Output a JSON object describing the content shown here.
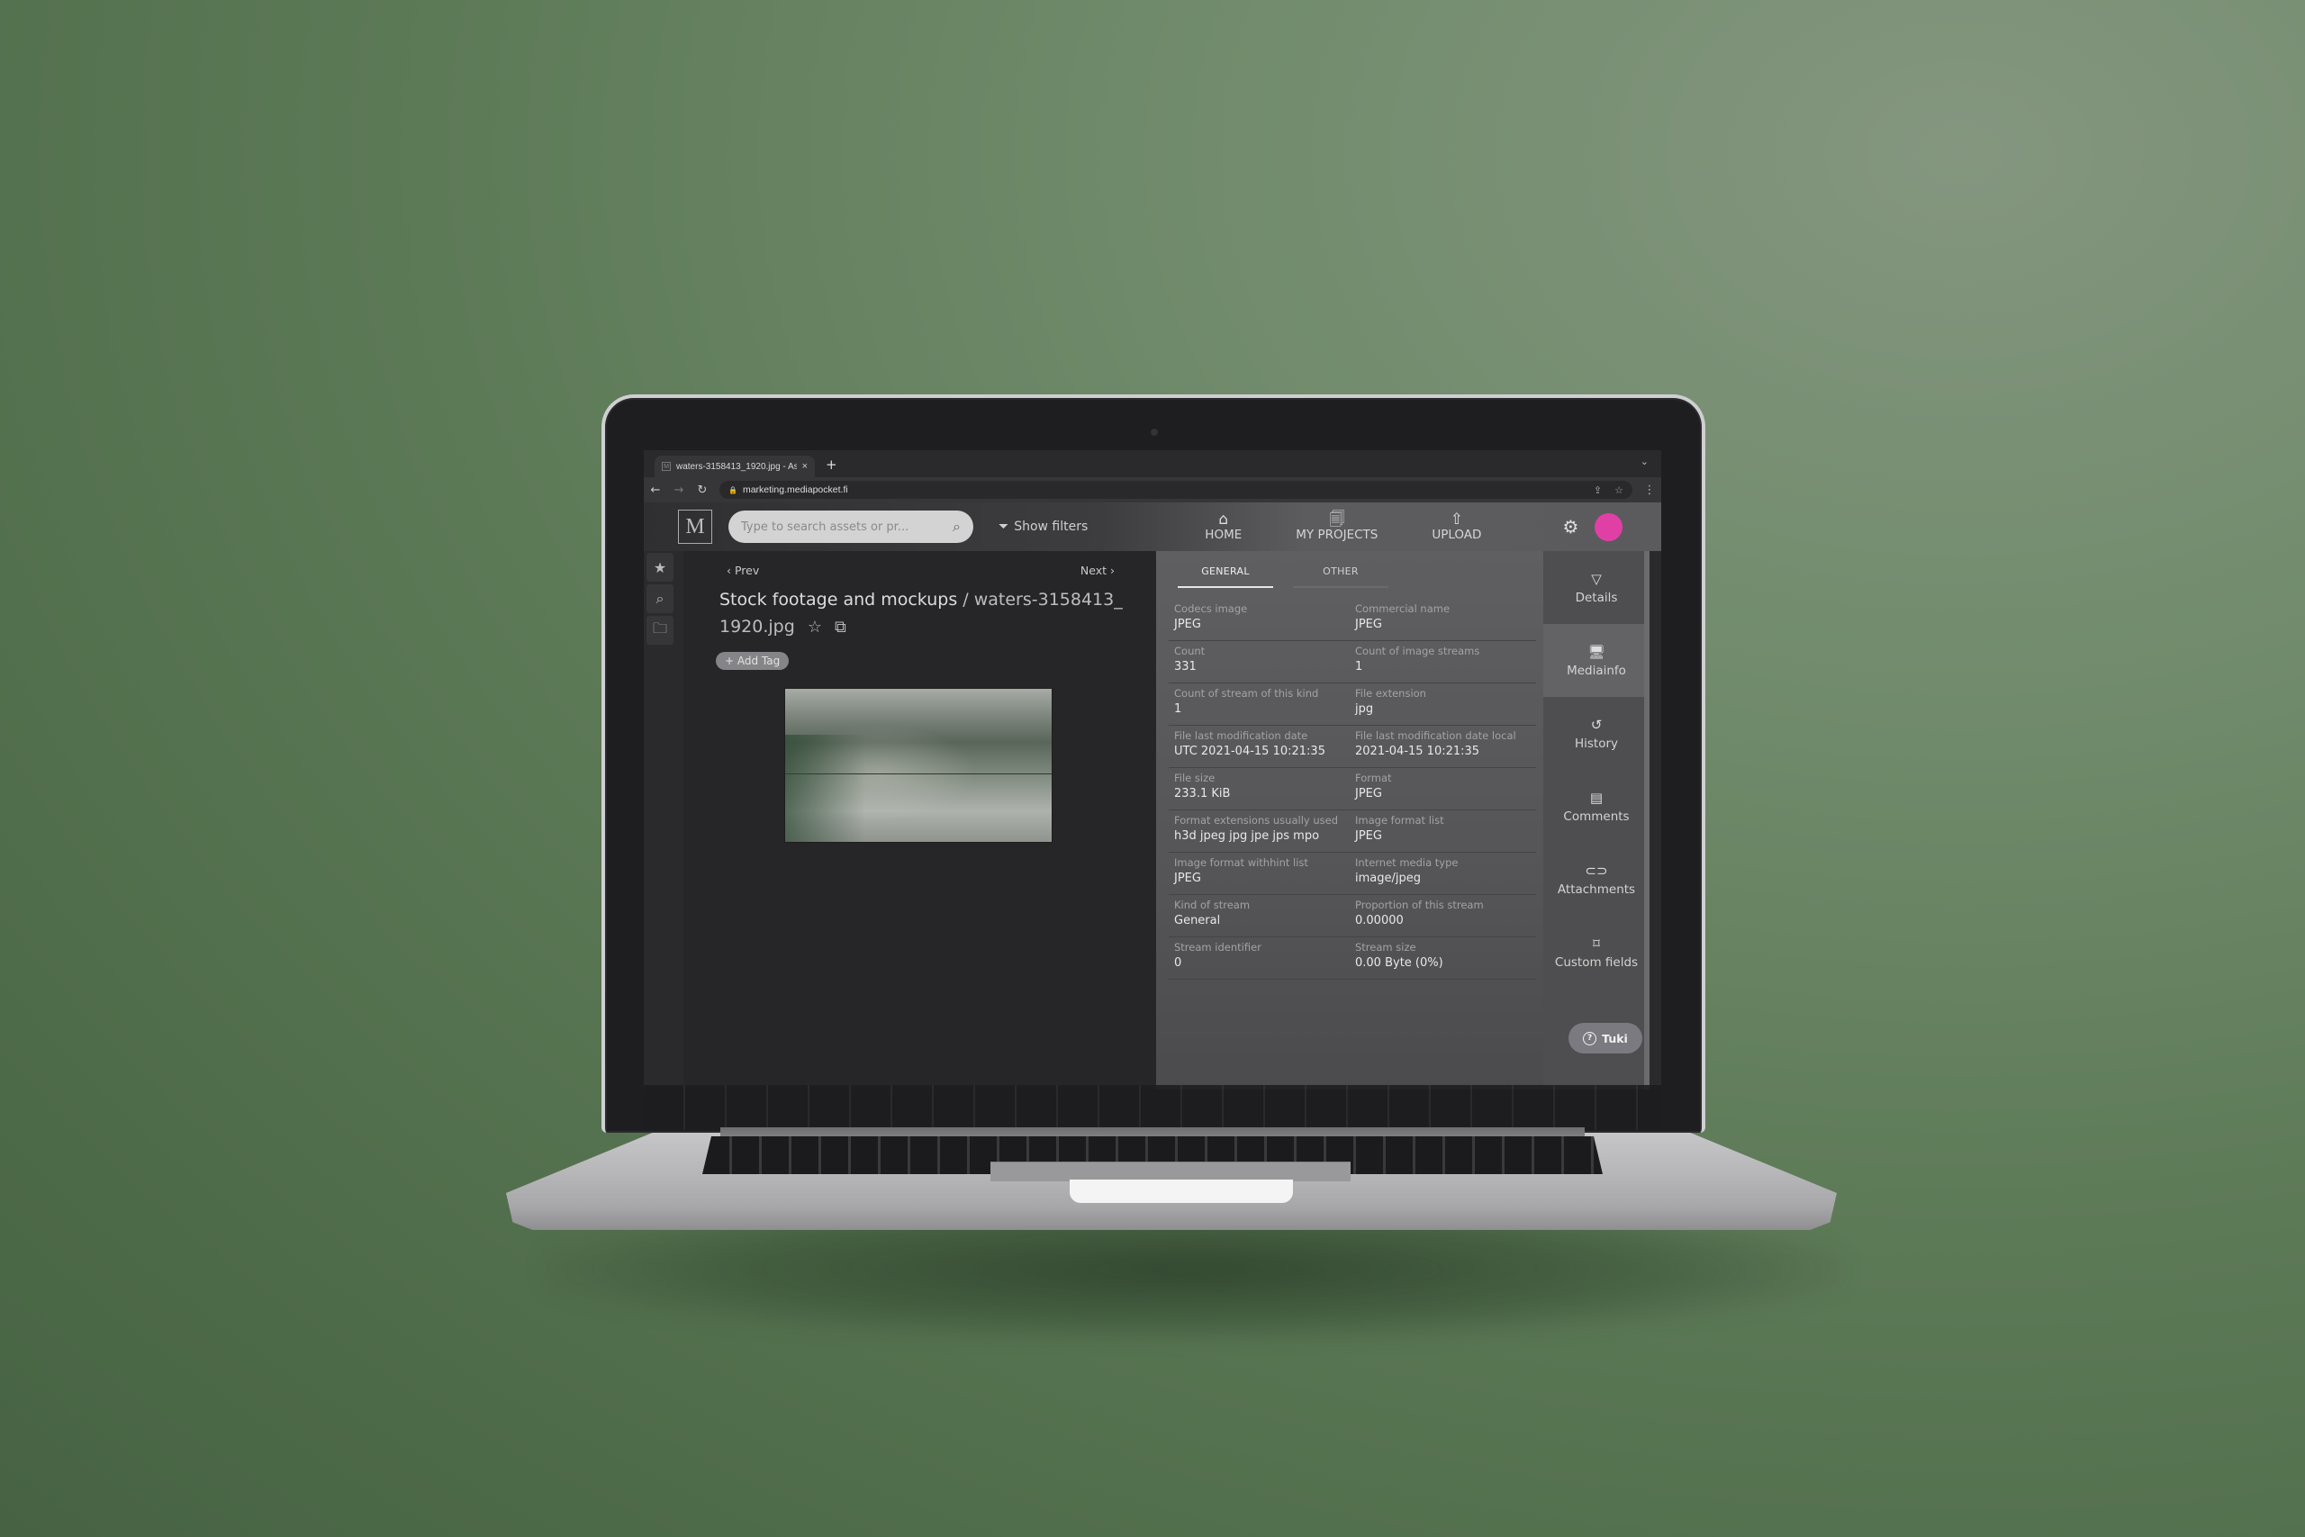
{
  "browser": {
    "tab_title": "waters-3158413_1920.jpg - As",
    "tab_favicon": "M",
    "tab_close": "×",
    "new_tab": "+",
    "tab_dropdown": "⌄",
    "url": "marketing.mediapocket.fi",
    "icons": {
      "back": "←",
      "forward": "→",
      "reload": "↻",
      "lock": "🔒",
      "share": "⇪",
      "bookmark": "☆",
      "menu": "⋮"
    }
  },
  "header": {
    "logo": "M",
    "search_placeholder": "Type to search assets or pr...",
    "search_icon": "⌕",
    "filters_icon": "⏷",
    "filters_label": "Show filters",
    "nav": [
      {
        "icon": "⌂",
        "label": "HOME"
      },
      {
        "icon": "🗐",
        "label": "MY PROJECTS"
      },
      {
        "icon": "⇧",
        "label": "UPLOAD"
      }
    ],
    "settings_icon": "⚙",
    "avatar_color": "#e040a6"
  },
  "rail": [
    {
      "icon": "★",
      "name": "favorites"
    },
    {
      "icon": "⌕",
      "name": "search"
    },
    {
      "icon": "🗀",
      "name": "collections"
    }
  ],
  "viewer": {
    "prev_label": "Prev",
    "next_label": "Next",
    "prev_icon": "‹",
    "next_icon": "›",
    "folder": "Stock footage and mockups",
    "separator": " / ",
    "filename": "waters-3158413_1920.jpg",
    "star_icon": "☆",
    "add_to_project_icon": "⧉",
    "add_tag_label": "+ Add Tag"
  },
  "mediainfo": {
    "tabs": [
      {
        "label": "GENERAL",
        "active": true
      },
      {
        "label": "OTHER",
        "active": false
      }
    ],
    "rows": [
      [
        {
          "label": "Codecs image",
          "value": "JPEG"
        },
        {
          "label": "Commercial name",
          "value": "JPEG"
        }
      ],
      [
        {
          "label": "Count",
          "value": "331"
        },
        {
          "label": "Count of image streams",
          "value": "1"
        }
      ],
      [
        {
          "label": "Count of stream of this kind",
          "value": "1"
        },
        {
          "label": "File extension",
          "value": "jpg"
        }
      ],
      [
        {
          "label": "File last modification date",
          "value": "UTC 2021-04-15 10:21:35"
        },
        {
          "label": "File last modification date local",
          "value": "2021-04-15 10:21:35"
        }
      ],
      [
        {
          "label": "File size",
          "value": "233.1 KiB"
        },
        {
          "label": "Format",
          "value": "JPEG"
        }
      ],
      [
        {
          "label": "Format extensions usually used",
          "value": "h3d jpeg jpg jpe jps mpo"
        },
        {
          "label": "Image format list",
          "value": "JPEG"
        }
      ],
      [
        {
          "label": "Image format withhint list",
          "value": "JPEG"
        },
        {
          "label": "Internet media type",
          "value": "image/jpeg"
        }
      ],
      [
        {
          "label": "Kind of stream",
          "value": "General"
        },
        {
          "label": "Proportion of this stream",
          "value": "0.00000"
        }
      ],
      [
        {
          "label": "Stream identifier",
          "value": "0"
        },
        {
          "label": "Stream size",
          "value": "0.00 Byte (0%)"
        }
      ]
    ]
  },
  "sidetabs": [
    {
      "icon": "▽",
      "label": "Details",
      "active": false
    },
    {
      "icon": "🖥",
      "label": "Mediainfo",
      "active": true
    },
    {
      "icon": "↺",
      "label": "History",
      "active": false
    },
    {
      "icon": "▤",
      "label": "Comments",
      "active": false
    },
    {
      "icon": "⊂⊃",
      "label": "Attachments",
      "active": false
    },
    {
      "icon": "⌑",
      "label": "Custom fields",
      "active": false
    }
  ],
  "support": {
    "icon": "?",
    "label": "Tuki"
  }
}
